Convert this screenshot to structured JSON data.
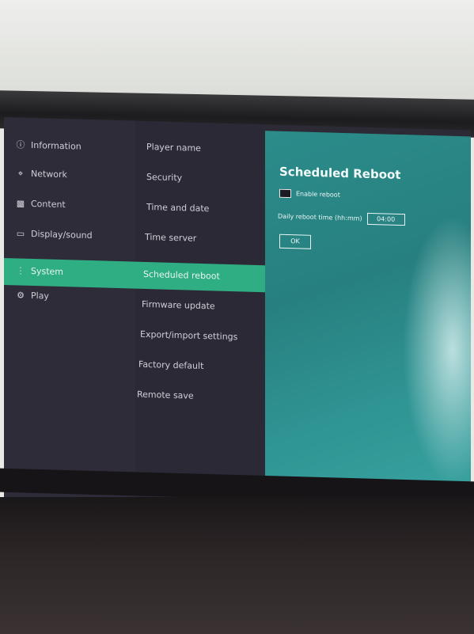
{
  "sidebar": {
    "items": [
      {
        "label": "Information",
        "icon": "info-icon"
      },
      {
        "label": "Network",
        "icon": "network-icon"
      },
      {
        "label": "Content",
        "icon": "storage-icon"
      },
      {
        "label": "Display/sound",
        "icon": "monitor-icon"
      },
      {
        "label": "System",
        "icon": "system-icon"
      },
      {
        "label": "Play",
        "icon": "play-icon"
      }
    ],
    "selected_index": 4
  },
  "submenu": {
    "items": [
      {
        "label": "Player name"
      },
      {
        "label": "Security"
      },
      {
        "label": "Time and date"
      },
      {
        "label": "Time server"
      },
      {
        "label": "Scheduled reboot"
      },
      {
        "label": "Firmware update"
      },
      {
        "label": "Export/import settings"
      },
      {
        "label": "Factory default"
      },
      {
        "label": "Remote save"
      }
    ],
    "selected_index": 4
  },
  "detail": {
    "title": "Scheduled Reboot",
    "enable_label": "Enable reboot",
    "daily_label": "Daily reboot time (hh:mm)",
    "time_value": "04:00",
    "ok_label": "OK"
  },
  "colors": {
    "highlight": "#2fae84",
    "panel": "#2b8c8a",
    "background": "#2b2a35"
  }
}
